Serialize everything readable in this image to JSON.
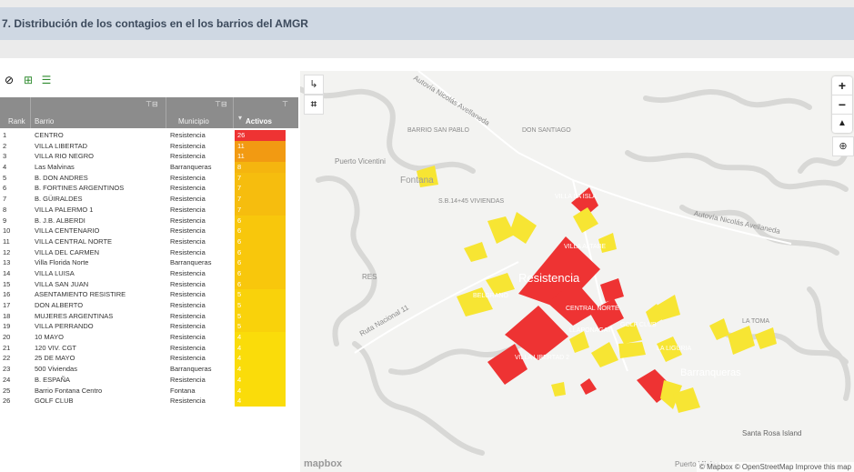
{
  "header": {
    "title": "7. Distribución de los contagios en el los barrios del AMGR"
  },
  "toolbar": {
    "icons": [
      "clear-filter-icon",
      "table-export-icon",
      "column-filter-icon"
    ]
  },
  "table": {
    "columns": {
      "rank": "Rank",
      "barrio": "Barrio",
      "municipio": "Municipio",
      "activos": "Activos"
    },
    "rows": [
      {
        "rank": "1",
        "barrio": "CENTRO",
        "municipio": "Resistencia",
        "activos": "26",
        "color": "#ee3333"
      },
      {
        "rank": "2",
        "barrio": "VILLA LIBERTAD",
        "municipio": "Resistencia",
        "activos": "11",
        "color": "#f29a12"
      },
      {
        "rank": "3",
        "barrio": "VILLA RIO NEGRO",
        "municipio": "Resistencia",
        "activos": "11",
        "color": "#f29a12"
      },
      {
        "rank": "4",
        "barrio": "Las Malvinas",
        "municipio": "Barranqueras",
        "activos": "8",
        "color": "#f5b50f"
      },
      {
        "rank": "5",
        "barrio": "B. DON ANDRES",
        "municipio": "Resistencia",
        "activos": "7",
        "color": "#f6bd0e"
      },
      {
        "rank": "6",
        "barrio": "B. FORTINES ARGENTINOS",
        "municipio": "Resistencia",
        "activos": "7",
        "color": "#f6bd0e"
      },
      {
        "rank": "7",
        "barrio": "B. GÜIRALDES",
        "municipio": "Resistencia",
        "activos": "7",
        "color": "#f6bd0e"
      },
      {
        "rank": "8",
        "barrio": "VILLA PALERMO 1",
        "municipio": "Resistencia",
        "activos": "7",
        "color": "#f6bd0e"
      },
      {
        "rank": "9",
        "barrio": "B. J.B. ALBERDI",
        "municipio": "Resistencia",
        "activos": "6",
        "color": "#f8c70c"
      },
      {
        "rank": "10",
        "barrio": "VILLA CENTENARIO",
        "municipio": "Resistencia",
        "activos": "6",
        "color": "#f8c70c"
      },
      {
        "rank": "11",
        "barrio": "VILLA CENTRAL NORTE",
        "municipio": "Resistencia",
        "activos": "6",
        "color": "#f8c70c"
      },
      {
        "rank": "12",
        "barrio": "VILLA DEL CARMEN",
        "municipio": "Resistencia",
        "activos": "6",
        "color": "#f8c70c"
      },
      {
        "rank": "13",
        "barrio": "Villa Florida Norte",
        "municipio": "Barranqueras",
        "activos": "6",
        "color": "#f8c70c"
      },
      {
        "rank": "14",
        "barrio": "VILLA LUISA",
        "municipio": "Resistencia",
        "activos": "6",
        "color": "#f8c70c"
      },
      {
        "rank": "15",
        "barrio": "VILLA SAN JUAN",
        "municipio": "Resistencia",
        "activos": "6",
        "color": "#f8c70c"
      },
      {
        "rank": "16",
        "barrio": "ASENTAMIENTO RESISTIRE",
        "municipio": "Resistencia",
        "activos": "5",
        "color": "#f9d20b"
      },
      {
        "rank": "17",
        "barrio": "DON ALBERTO",
        "municipio": "Resistencia",
        "activos": "5",
        "color": "#f9d20b"
      },
      {
        "rank": "18",
        "barrio": "MUJERES ARGENTINAS",
        "municipio": "Resistencia",
        "activos": "5",
        "color": "#f9d20b"
      },
      {
        "rank": "19",
        "barrio": "VILLA PERRANDO",
        "municipio": "Resistencia",
        "activos": "5",
        "color": "#f9d20b"
      },
      {
        "rank": "20",
        "barrio": "10 MAYO",
        "municipio": "Resistencia",
        "activos": "4",
        "color": "#fadc0a"
      },
      {
        "rank": "21",
        "barrio": "120 VIV. CGT",
        "municipio": "Resistencia",
        "activos": "4",
        "color": "#fadc0a"
      },
      {
        "rank": "22",
        "barrio": "25 DE MAYO",
        "municipio": "Resistencia",
        "activos": "4",
        "color": "#fadc0a"
      },
      {
        "rank": "23",
        "barrio": "500 Viviendas",
        "municipio": "Barranqueras",
        "activos": "4",
        "color": "#fadc0a"
      },
      {
        "rank": "24",
        "barrio": "B. ESPAÑA",
        "municipio": "Resistencia",
        "activos": "4",
        "color": "#fadc0a"
      },
      {
        "rank": "25",
        "barrio": "Barrio Fontana Centro",
        "municipio": "Fontana",
        "activos": "4",
        "color": "#fadc0a"
      },
      {
        "rank": "26",
        "barrio": "GOLF CLUB",
        "municipio": "Resistencia",
        "activos": "4",
        "color": "#fadc0a"
      }
    ]
  },
  "map": {
    "labels": {
      "resistencia": "Resistencia",
      "barranqueras": "Barranqueras",
      "fontana": "Fontana",
      "puerto_vicentini": "Puerto Vicentini",
      "res": "RES",
      "santa_rosa": "Santa Rosa Island",
      "puerto_vilelas": "Puerto Vilelas",
      "avellaneda_1": "Autovía Nicolás Avellaneda",
      "avellaneda_2": "Autovía Nicolás Avellaneda",
      "ruta11": "Ruta Nacional 11",
      "barrio_san_pablo": "BARRIO SAN PABLO",
      "don_santiago": "DON SANTIAGO",
      "sb_viviendas": "S.B.14+45 VIVIENDAS",
      "villa_la_isla": "VILLA LA ISLA",
      "villa_altabe": "VILLA ALTABE",
      "belgrano": "BELGRANO",
      "central_norte": "CENTRAL NORTE",
      "llaponagat": "LLAPONAGAT",
      "villa_libertad_2": "VILLA LIBERTAD 2",
      "golf_club": "GOLF CLUB",
      "la_liguria": "LA LIGURIA",
      "la_toma": "LA TOMA"
    },
    "zoom_in": "+",
    "zoom_out": "−",
    "north": "▲",
    "attribution": "© Mapbox © OpenStreetMap  Improve this map",
    "logo": "mapbox",
    "colors": {
      "high": "#ee3333",
      "mid": "#f29a12",
      "low": "#f7e533"
    }
  }
}
